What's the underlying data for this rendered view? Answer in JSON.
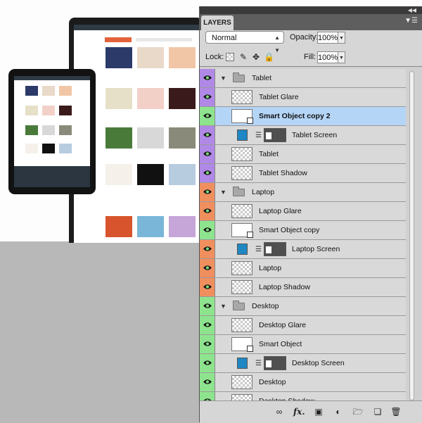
{
  "panel": {
    "title": "LAYERS",
    "collapse_icon": "double-chevron-right-icon",
    "menu_icon": "panel-menu-icon",
    "blend_mode": "Normal",
    "opacity_label": "Opacity:",
    "opacity_value": "100%",
    "lock_label": "Lock:",
    "fill_label": "Fill:",
    "fill_value": "100%"
  },
  "layer_colors": {
    "purple": "#b088e6",
    "orange": "#f08f5e",
    "green": "#8ee48e",
    "selected": "#b5d5f7"
  },
  "layers": [
    {
      "name": "Tablet",
      "kind": "group",
      "color": "purple"
    },
    {
      "name": "Tablet Glare",
      "kind": "layer",
      "color": "purple"
    },
    {
      "name": "Smart Object copy 2",
      "kind": "smart-object",
      "color": "green",
      "selected": true
    },
    {
      "name": "Tablet Screen",
      "kind": "masked",
      "color": "purple"
    },
    {
      "name": "Tablet",
      "kind": "layer",
      "color": "purple"
    },
    {
      "name": "Tablet Shadow",
      "kind": "layer",
      "color": "purple"
    },
    {
      "name": "Laptop",
      "kind": "group",
      "color": "orange"
    },
    {
      "name": "Laptop Glare",
      "kind": "layer",
      "color": "orange"
    },
    {
      "name": "Smart Object copy",
      "kind": "smart-object",
      "color": "green"
    },
    {
      "name": "Laptop Screen",
      "kind": "masked",
      "color": "orange"
    },
    {
      "name": "Laptop",
      "kind": "layer",
      "color": "orange"
    },
    {
      "name": "Laptop Shadow",
      "kind": "layer",
      "color": "orange"
    },
    {
      "name": "Desktop",
      "kind": "group",
      "color": "green"
    },
    {
      "name": "Desktop Glare",
      "kind": "layer",
      "color": "green"
    },
    {
      "name": "Smart Object",
      "kind": "smart-object",
      "color": "green"
    },
    {
      "name": "Desktop Screen",
      "kind": "masked",
      "color": "green"
    },
    {
      "name": "Desktop",
      "kind": "layer",
      "color": "green"
    },
    {
      "name": "Desktop Shadow",
      "kind": "layer",
      "color": "green"
    }
  ],
  "toolbar_icons": [
    "link-layers-icon",
    "fx-icon",
    "add-mask-icon",
    "adjustment-layer-icon",
    "new-group-icon",
    "new-layer-icon",
    "trash-icon"
  ],
  "toolbar_labels": {
    "fx": "fx."
  }
}
